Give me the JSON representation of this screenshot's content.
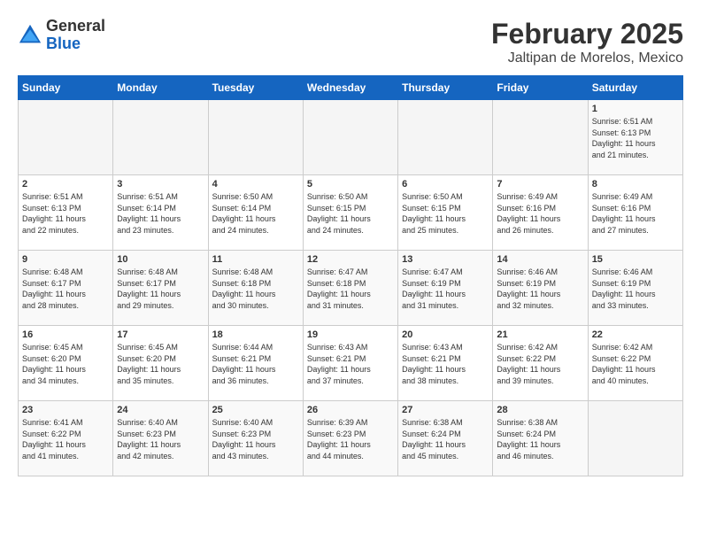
{
  "header": {
    "logo_general": "General",
    "logo_blue": "Blue",
    "month_title": "February 2025",
    "subtitle": "Jaltipan de Morelos, Mexico"
  },
  "days_of_week": [
    "Sunday",
    "Monday",
    "Tuesday",
    "Wednesday",
    "Thursday",
    "Friday",
    "Saturday"
  ],
  "weeks": [
    [
      {
        "day": "",
        "info": ""
      },
      {
        "day": "",
        "info": ""
      },
      {
        "day": "",
        "info": ""
      },
      {
        "day": "",
        "info": ""
      },
      {
        "day": "",
        "info": ""
      },
      {
        "day": "",
        "info": ""
      },
      {
        "day": "1",
        "info": "Sunrise: 6:51 AM\nSunset: 6:13 PM\nDaylight: 11 hours\nand 21 minutes."
      }
    ],
    [
      {
        "day": "2",
        "info": "Sunrise: 6:51 AM\nSunset: 6:13 PM\nDaylight: 11 hours\nand 22 minutes."
      },
      {
        "day": "3",
        "info": "Sunrise: 6:51 AM\nSunset: 6:14 PM\nDaylight: 11 hours\nand 23 minutes."
      },
      {
        "day": "4",
        "info": "Sunrise: 6:50 AM\nSunset: 6:14 PM\nDaylight: 11 hours\nand 24 minutes."
      },
      {
        "day": "5",
        "info": "Sunrise: 6:50 AM\nSunset: 6:15 PM\nDaylight: 11 hours\nand 24 minutes."
      },
      {
        "day": "6",
        "info": "Sunrise: 6:50 AM\nSunset: 6:15 PM\nDaylight: 11 hours\nand 25 minutes."
      },
      {
        "day": "7",
        "info": "Sunrise: 6:49 AM\nSunset: 6:16 PM\nDaylight: 11 hours\nand 26 minutes."
      },
      {
        "day": "8",
        "info": "Sunrise: 6:49 AM\nSunset: 6:16 PM\nDaylight: 11 hours\nand 27 minutes."
      }
    ],
    [
      {
        "day": "9",
        "info": "Sunrise: 6:48 AM\nSunset: 6:17 PM\nDaylight: 11 hours\nand 28 minutes."
      },
      {
        "day": "10",
        "info": "Sunrise: 6:48 AM\nSunset: 6:17 PM\nDaylight: 11 hours\nand 29 minutes."
      },
      {
        "day": "11",
        "info": "Sunrise: 6:48 AM\nSunset: 6:18 PM\nDaylight: 11 hours\nand 30 minutes."
      },
      {
        "day": "12",
        "info": "Sunrise: 6:47 AM\nSunset: 6:18 PM\nDaylight: 11 hours\nand 31 minutes."
      },
      {
        "day": "13",
        "info": "Sunrise: 6:47 AM\nSunset: 6:19 PM\nDaylight: 11 hours\nand 31 minutes."
      },
      {
        "day": "14",
        "info": "Sunrise: 6:46 AM\nSunset: 6:19 PM\nDaylight: 11 hours\nand 32 minutes."
      },
      {
        "day": "15",
        "info": "Sunrise: 6:46 AM\nSunset: 6:19 PM\nDaylight: 11 hours\nand 33 minutes."
      }
    ],
    [
      {
        "day": "16",
        "info": "Sunrise: 6:45 AM\nSunset: 6:20 PM\nDaylight: 11 hours\nand 34 minutes."
      },
      {
        "day": "17",
        "info": "Sunrise: 6:45 AM\nSunset: 6:20 PM\nDaylight: 11 hours\nand 35 minutes."
      },
      {
        "day": "18",
        "info": "Sunrise: 6:44 AM\nSunset: 6:21 PM\nDaylight: 11 hours\nand 36 minutes."
      },
      {
        "day": "19",
        "info": "Sunrise: 6:43 AM\nSunset: 6:21 PM\nDaylight: 11 hours\nand 37 minutes."
      },
      {
        "day": "20",
        "info": "Sunrise: 6:43 AM\nSunset: 6:21 PM\nDaylight: 11 hours\nand 38 minutes."
      },
      {
        "day": "21",
        "info": "Sunrise: 6:42 AM\nSunset: 6:22 PM\nDaylight: 11 hours\nand 39 minutes."
      },
      {
        "day": "22",
        "info": "Sunrise: 6:42 AM\nSunset: 6:22 PM\nDaylight: 11 hours\nand 40 minutes."
      }
    ],
    [
      {
        "day": "23",
        "info": "Sunrise: 6:41 AM\nSunset: 6:22 PM\nDaylight: 11 hours\nand 41 minutes."
      },
      {
        "day": "24",
        "info": "Sunrise: 6:40 AM\nSunset: 6:23 PM\nDaylight: 11 hours\nand 42 minutes."
      },
      {
        "day": "25",
        "info": "Sunrise: 6:40 AM\nSunset: 6:23 PM\nDaylight: 11 hours\nand 43 minutes."
      },
      {
        "day": "26",
        "info": "Sunrise: 6:39 AM\nSunset: 6:23 PM\nDaylight: 11 hours\nand 44 minutes."
      },
      {
        "day": "27",
        "info": "Sunrise: 6:38 AM\nSunset: 6:24 PM\nDaylight: 11 hours\nand 45 minutes."
      },
      {
        "day": "28",
        "info": "Sunrise: 6:38 AM\nSunset: 6:24 PM\nDaylight: 11 hours\nand 46 minutes."
      },
      {
        "day": "",
        "info": ""
      }
    ]
  ]
}
